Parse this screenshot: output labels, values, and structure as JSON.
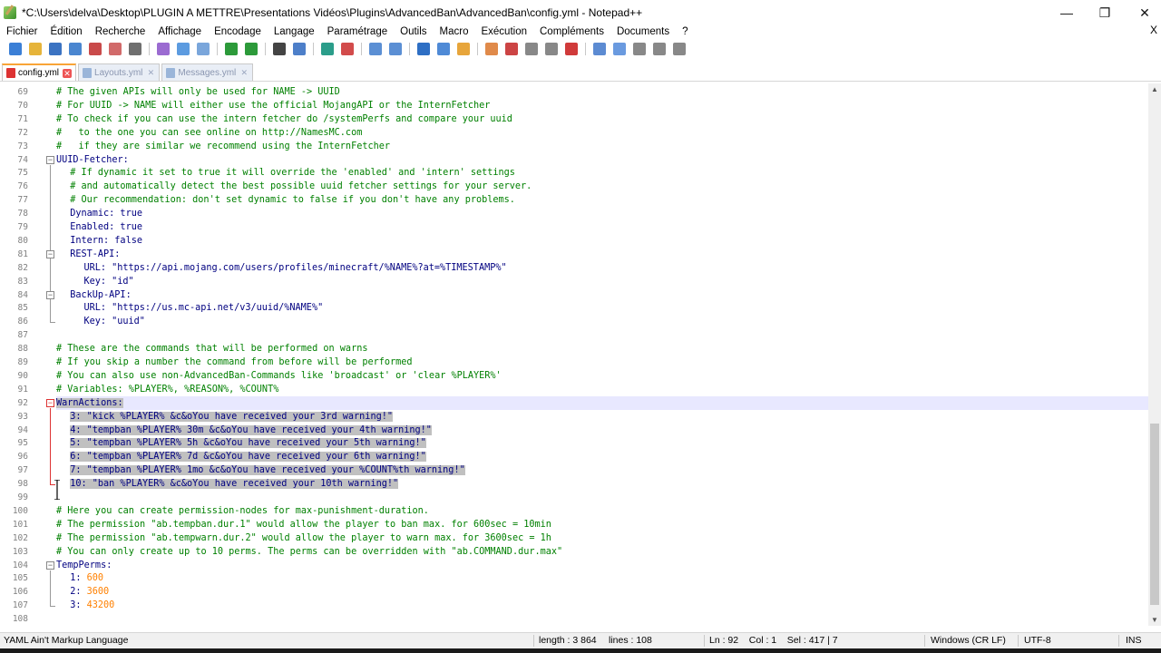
{
  "window": {
    "title": "*C:\\Users\\delva\\Desktop\\PLUGIN A METTRE\\Presentations Vidéos\\Plugins\\AdvancedBan\\AdvancedBan\\config.yml - Notepad++",
    "controls": {
      "minimize": "—",
      "maximize": "❐",
      "close": "✕"
    }
  },
  "menu": {
    "items": [
      "Fichier",
      "Édition",
      "Recherche",
      "Affichage",
      "Encodage",
      "Langage",
      "Paramétrage",
      "Outils",
      "Macro",
      "Exécution",
      "Compléments",
      "Documents",
      "?"
    ],
    "close_doc": "X"
  },
  "toolbar": {
    "icons": [
      "new-file-icon",
      "open-file-icon",
      "save-icon",
      "save-all-icon",
      "close-icon",
      "close-all-icon",
      "print-icon",
      "sep",
      "cut-icon",
      "copy-icon",
      "paste-icon",
      "sep",
      "undo-icon",
      "redo-icon",
      "sep",
      "find-icon",
      "replace-icon",
      "sep",
      "zoom-in-icon",
      "zoom-out-icon",
      "sep",
      "sync-v-icon",
      "sync-h-icon",
      "sep",
      "word-wrap-icon",
      "all-chars-icon",
      "indent-guide-icon",
      "sep",
      "udl-icon",
      "doc-map-icon",
      "function-list-icon",
      "folder-workspace-icon",
      "monitoring-icon",
      "sep",
      "record-macro-icon",
      "stop-macro-icon",
      "play-macro-icon",
      "run-macro-multiple-icon",
      "save-macro-icon"
    ],
    "icon_colors": [
      "#3b7fd6",
      "#e6b43a",
      "#3b73c2",
      "#4a86d0",
      "#c94a4a",
      "#d16a6a",
      "#6f6f6f",
      "",
      "#9b6bd1",
      "#5c9be0",
      "#7aa6db",
      "",
      "#2c9a3a",
      "#2c9a3a",
      "",
      "#444",
      "#4d7fc9",
      "",
      "#2b9d8a",
      "#d24b4b",
      "",
      "#5b8fd4",
      "#5b8fd4",
      "",
      "#2e6fc4",
      "#4f8ad6",
      "#e7a53b",
      "",
      "#e08a4a",
      "#c44",
      "#888",
      "",
      "#d03a3a",
      "#9a9a9a",
      "#5c8bd2",
      "#6a9adf",
      "#888"
    ]
  },
  "tabs": [
    {
      "label": "config.yml",
      "active": true,
      "close": "✕"
    },
    {
      "label": "Layouts.yml",
      "active": false,
      "close": "✕"
    },
    {
      "label": "Messages.yml",
      "active": false,
      "close": "✕"
    }
  ],
  "editor": {
    "current_line": 92,
    "lines": [
      {
        "n": "69",
        "text": "# The given APIs will only be used for NAME -> UUID",
        "kind": "comment",
        "indent": 0
      },
      {
        "n": "70",
        "text": "# For UUID -> NAME will either use the official MojangAPI or the InternFetcher",
        "kind": "comment",
        "indent": 0
      },
      {
        "n": "71",
        "text": "# To check if you can use the intern fetcher do /systemPerfs and compare your uuid",
        "kind": "comment",
        "indent": 0
      },
      {
        "n": "72",
        "text": "#   to the one you can see online on http://NamesMC.com",
        "kind": "comment",
        "indent": 0
      },
      {
        "n": "73",
        "text": "#   if they are similar we recommend using the InternFetcher",
        "kind": "comment",
        "indent": 0
      },
      {
        "n": "74",
        "text": "UUID-Fetcher:",
        "kind": "key",
        "indent": 0
      },
      {
        "n": "75",
        "text": "# If dynamic it set to true it will override the 'enabled' and 'intern' settings",
        "kind": "comment",
        "indent": 2
      },
      {
        "n": "76",
        "text": "# and automatically detect the best possible uuid fetcher settings for your server.",
        "kind": "comment",
        "indent": 2
      },
      {
        "n": "77",
        "text": "# Our recommendation: don't set dynamic to false if you don't have any problems.",
        "kind": "comment",
        "indent": 2
      },
      {
        "n": "78",
        "text": "Dynamic: true",
        "kind": "key",
        "indent": 2
      },
      {
        "n": "79",
        "text": "Enabled: true",
        "kind": "key",
        "indent": 2
      },
      {
        "n": "80",
        "text": "Intern: false",
        "kind": "key",
        "indent": 2
      },
      {
        "n": "81",
        "text": "REST-API:",
        "kind": "key",
        "indent": 2
      },
      {
        "n": "82",
        "text": "URL: \"https://api.mojang.com/users/profiles/minecraft/%NAME%?at=%TIMESTAMP%\"",
        "kind": "key",
        "indent": 4
      },
      {
        "n": "83",
        "text": "Key: \"id\"",
        "kind": "key",
        "indent": 4
      },
      {
        "n": "84",
        "text": "BackUp-API:",
        "kind": "key",
        "indent": 2
      },
      {
        "n": "85",
        "text": "URL: \"https://us.mc-api.net/v3/uuid/%NAME%\"",
        "kind": "key",
        "indent": 4
      },
      {
        "n": "86",
        "text": "Key: \"uuid\"",
        "kind": "key",
        "indent": 4
      },
      {
        "n": "87",
        "text": "",
        "kind": "blank",
        "indent": 0
      },
      {
        "n": "88",
        "text": "# These are the commands that will be performed on warns",
        "kind": "comment",
        "indent": 0
      },
      {
        "n": "89",
        "text": "# If you skip a number the command from before will be performed",
        "kind": "comment",
        "indent": 0
      },
      {
        "n": "90",
        "text": "# You can also use non-AdvancedBan-Commands like 'broadcast' or 'clear %PLAYER%'",
        "kind": "comment",
        "indent": 0
      },
      {
        "n": "91",
        "text": "# Variables: %PLAYER%, %REASON%, %COUNT%",
        "kind": "comment",
        "indent": 0
      },
      {
        "n": "92",
        "text": "WarnActions:",
        "kind": "key",
        "indent": 0,
        "selected": true
      },
      {
        "n": "93",
        "text": "3: \"kick %PLAYER% &c&oYou have received your 3rd warning!\"",
        "kind": "key",
        "indent": 2,
        "selected": true
      },
      {
        "n": "94",
        "text": "4: \"tempban %PLAYER% 30m &c&oYou have received your 4th warning!\"",
        "kind": "key",
        "indent": 2,
        "selected": true
      },
      {
        "n": "95",
        "text": "5: \"tempban %PLAYER% 5h &c&oYou have received your 5th warning!\"",
        "kind": "key",
        "indent": 2,
        "selected": true
      },
      {
        "n": "96",
        "text": "6: \"tempban %PLAYER% 7d &c&oYou have received your 6th warning!\"",
        "kind": "key",
        "indent": 2,
        "selected": true
      },
      {
        "n": "97",
        "text": "7: \"tempban %PLAYER% 1mo &c&oYou have received your %COUNT%th warning!\"",
        "kind": "key",
        "indent": 2,
        "selected": true
      },
      {
        "n": "98",
        "text": "10: \"ban %PLAYER% &c&oYou have received your 10th warning!\"",
        "kind": "key",
        "indent": 2,
        "selected": true
      },
      {
        "n": "99",
        "text": "",
        "kind": "blank",
        "indent": 0
      },
      {
        "n": "100",
        "text": "# Here you can create permission-nodes for max-punishment-duration.",
        "kind": "comment",
        "indent": 0
      },
      {
        "n": "101",
        "text": "# The permission \"ab.tempban.dur.1\" would allow the player to ban max. for 600sec = 10min",
        "kind": "comment",
        "indent": 0
      },
      {
        "n": "102",
        "text": "# The permission \"ab.tempwarn.dur.2\" would allow the player to warn max. for 3600sec = 1h",
        "kind": "comment",
        "indent": 0
      },
      {
        "n": "103",
        "text": "# You can only create up to 10 perms. The perms can be overridden with \"ab.COMMAND.dur.max\"",
        "kind": "comment",
        "indent": 0
      },
      {
        "n": "104",
        "text": "TempPerms:",
        "kind": "key",
        "indent": 0
      },
      {
        "n": "105",
        "key": "1: ",
        "num": "600",
        "kind": "numkey",
        "indent": 2
      },
      {
        "n": "106",
        "key": "2: ",
        "num": "3600",
        "kind": "numkey",
        "indent": 2
      },
      {
        "n": "107",
        "key": "3: ",
        "num": "43200",
        "kind": "numkey",
        "indent": 2
      },
      {
        "n": "108",
        "text": "",
        "kind": "blank",
        "indent": 0
      }
    ]
  },
  "statusbar": {
    "language": "YAML Ain't Markup Language",
    "length": "length : 3 864",
    "lines": "lines : 108",
    "position": "Ln : 92    Col : 1    Sel : 417 | 7",
    "eol": "Windows (CR LF)",
    "encoding": "UTF-8",
    "mode": "INS"
  }
}
